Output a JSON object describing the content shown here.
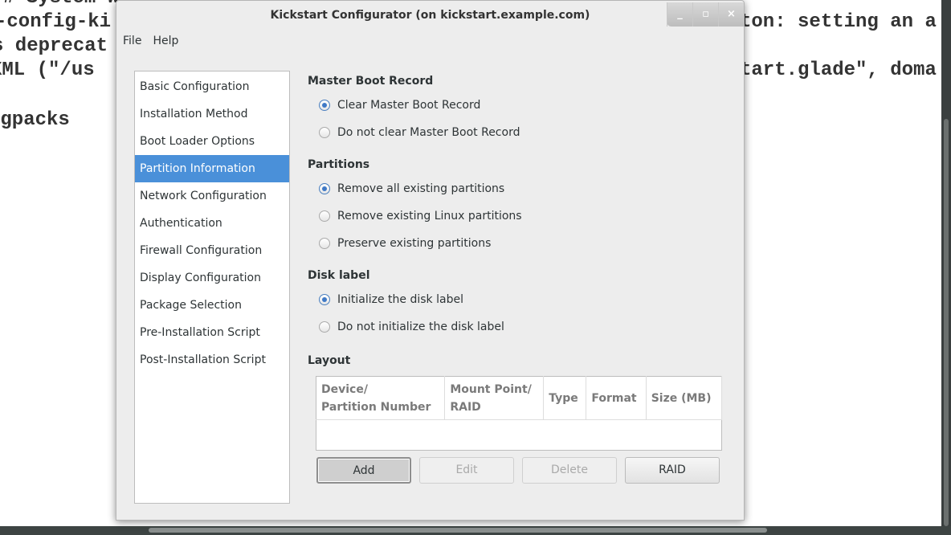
{
  "terminal": {
    "lines": [
      "# System window ...",
      "-config-ki",
      "s deprecat",
      "XML (\"/us",
      "ngpacks"
    ],
    "right_lines": [
      "ton: setting an a",
      "tart.glade\", doma"
    ]
  },
  "window": {
    "title": "Kickstart Configurator (on kickstart.example.com)",
    "controls": [
      "_",
      "▫",
      "×"
    ]
  },
  "menu": [
    "File",
    "Help"
  ],
  "sidebar": {
    "selected": "Partition Information",
    "items": [
      "Basic Configuration",
      "Installation Method",
      "Boot Loader Options",
      "Partition Information",
      "Network Configuration",
      "Authentication",
      "Firewall Configuration",
      "Display Configuration",
      "Package Selection",
      "Pre-Installation Script",
      "Post-Installation Script"
    ]
  },
  "mbr": {
    "title": "Master Boot Record",
    "options": [
      {
        "label": "Clear Master Boot Record",
        "selected": true
      },
      {
        "label": "Do not clear Master Boot Record",
        "selected": false
      }
    ]
  },
  "partitions": {
    "title": "Partitions",
    "options": [
      {
        "label": "Remove all existing partitions",
        "selected": true
      },
      {
        "label": "Remove existing Linux partitions",
        "selected": false
      },
      {
        "label": "Preserve existing partitions",
        "selected": false
      }
    ]
  },
  "disklabel": {
    "title": "Disk label",
    "options": [
      {
        "label": "Initialize the disk label",
        "selected": true
      },
      {
        "label": "Do not initialize the disk label",
        "selected": false
      }
    ]
  },
  "layout": {
    "title": "Layout",
    "columns": [
      "Device/\nPartition Number",
      "Mount Point/\nRAID",
      "Type",
      "Format",
      "Size (MB)"
    ],
    "rows": []
  },
  "buttons": {
    "add": "Add",
    "edit": "Edit",
    "delete": "Delete",
    "raid": "RAID"
  },
  "colors": {
    "accent": "#4a90d9"
  }
}
